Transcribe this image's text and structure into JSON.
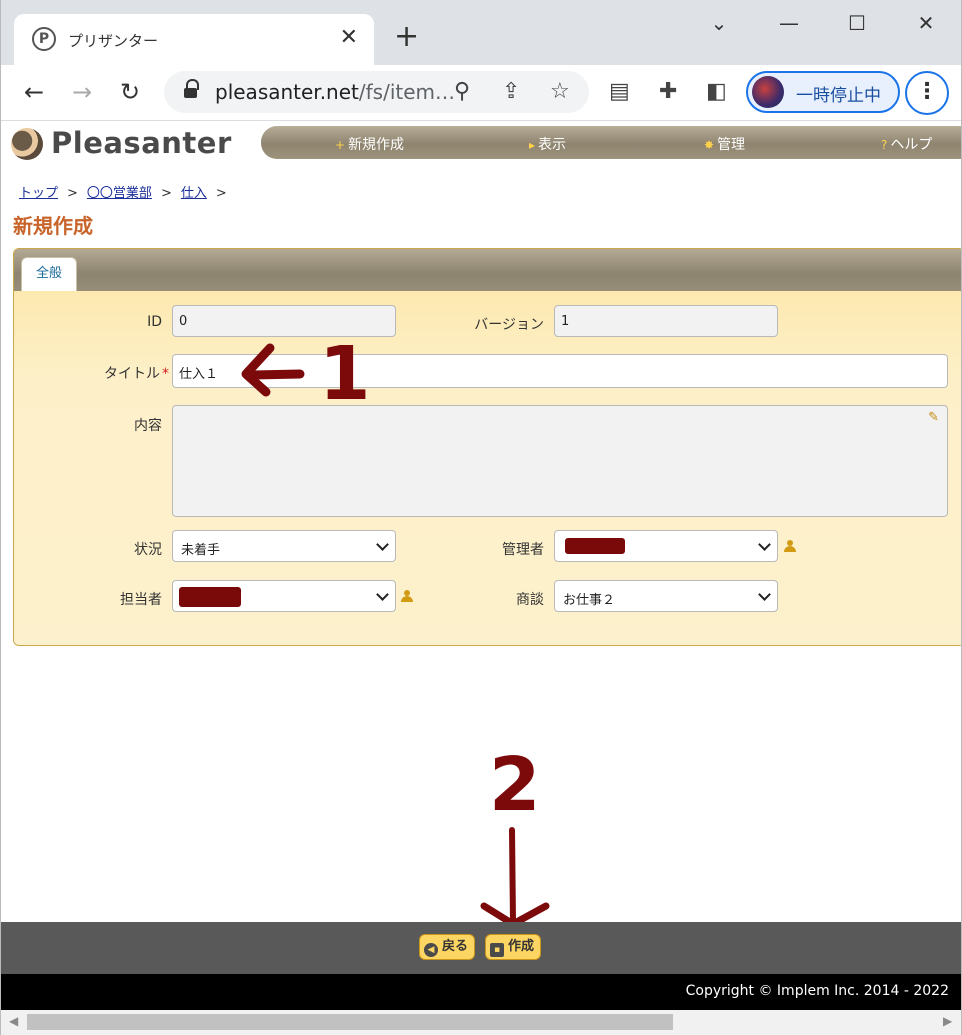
{
  "browser": {
    "tab_title": "プリザンター",
    "tab_favicon": "P",
    "close_glyph": "✕",
    "newtab_glyph": "+",
    "url_host": "pleasanter.net",
    "url_path": "/fs/item…",
    "profile_label": "一時停止中",
    "window_controls": [
      "⌄",
      "—",
      "☐",
      "✕"
    ]
  },
  "site": {
    "logo_text": "Pleasanter",
    "nav": [
      {
        "glyph": "+",
        "label": "新規作成"
      },
      {
        "glyph": "▸",
        "label": "表示"
      },
      {
        "glyph": "✸",
        "label": "管理"
      },
      {
        "glyph": "?",
        "label": "ヘルプ"
      }
    ]
  },
  "breadcrumb": [
    {
      "label": "トップ"
    },
    {
      "label": "〇〇営業部"
    },
    {
      "label": "仕入"
    }
  ],
  "breadcrumb_sep": ">",
  "page_title": "新規作成",
  "form": {
    "tab_label": "全般",
    "id": {
      "label": "ID",
      "value": "0"
    },
    "version": {
      "label": "バージョン",
      "value": "1"
    },
    "title": {
      "label": "タイトル",
      "required_mark": "*",
      "value": "仕入１"
    },
    "content": {
      "label": "内容",
      "value": ""
    },
    "status": {
      "label": "状況",
      "value": "未着手"
    },
    "manager": {
      "label": "管理者",
      "value": ""
    },
    "owner": {
      "label": "担当者",
      "value": ""
    },
    "deal": {
      "label": "商談",
      "value": "お仕事２"
    }
  },
  "annotations": {
    "one": "1",
    "two": "2"
  },
  "commands": {
    "back_label": "戻る",
    "create_label": "作成"
  },
  "copyright": "Copyright © Implem Inc. 2014 - 2022",
  "colors": {
    "accent_orange": "#c8642a",
    "panel_bg": "#fdf0c9",
    "button_yellow": "#fdd563",
    "annotation_red": "#7c0a0a"
  }
}
